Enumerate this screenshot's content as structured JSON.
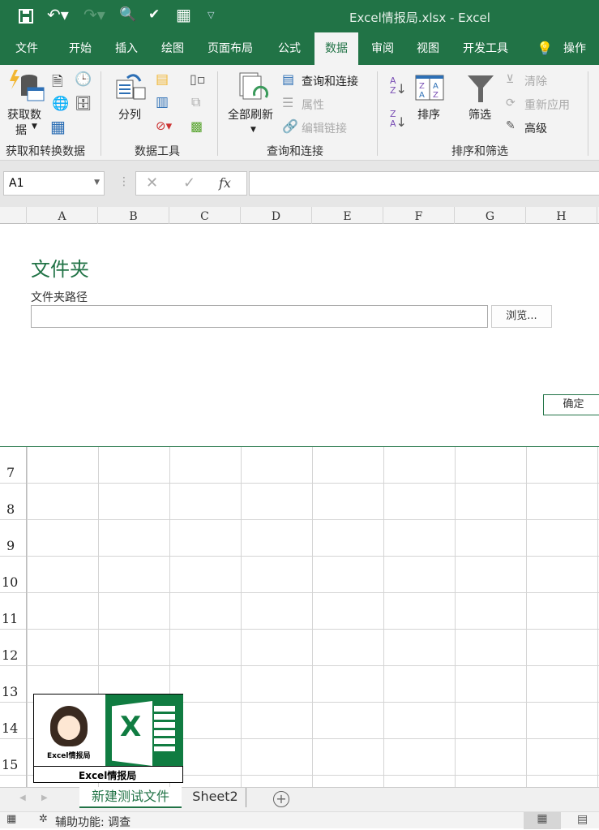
{
  "title_bar": {
    "title": "Excel情报局.xlsx  -  Excel",
    "qat_icons": [
      "save-icon",
      "undo-icon",
      "redo-icon",
      "print-preview-icon",
      "publish-icon",
      "table-icon",
      "customize-icon"
    ]
  },
  "tabs": [
    {
      "label": "文件"
    },
    {
      "label": "开始"
    },
    {
      "label": "插入"
    },
    {
      "label": "绘图"
    },
    {
      "label": "页面布局"
    },
    {
      "label": "公式"
    },
    {
      "label": "数据",
      "active": true
    },
    {
      "label": "审阅"
    },
    {
      "label": "视图"
    },
    {
      "label": "开发工具"
    },
    {
      "label": "操作说"
    }
  ],
  "ribbon": {
    "get_data": {
      "label1": "获取数",
      "label2": "据",
      "group": "获取和转换数据"
    },
    "data_tools": {
      "split": "分列",
      "group": "数据工具"
    },
    "queries": {
      "refresh_all": "全部刷新",
      "queries_connections": "查询和连接",
      "properties": "属性",
      "edit_links": "编辑链接",
      "group": "查询和连接"
    },
    "sort_filter": {
      "sort": "排序",
      "filter": "筛选",
      "clear": "清除",
      "reapply": "重新应用",
      "advanced": "高级",
      "group": "排序和筛选"
    }
  },
  "formula_bar": {
    "name_box": "A1",
    "fx": "fx",
    "formula": ""
  },
  "columns": [
    "A",
    "B",
    "C",
    "D",
    "E",
    "F",
    "G",
    "H"
  ],
  "dialog": {
    "title": "文件夹",
    "path_label": "文件夹路径",
    "path_value": "",
    "browse": "浏览...",
    "ok": "确定"
  },
  "rows": [
    "7",
    "8",
    "9",
    "10",
    "11",
    "12",
    "13",
    "14",
    "15"
  ],
  "logo": {
    "caption": "Excel情报局",
    "small_caption": "Excel情报局"
  },
  "sheets": [
    {
      "label": "新建测试文件",
      "active": true
    },
    {
      "label": "Sheet2"
    }
  ],
  "status": {
    "accessibility": "辅助功能: 调查"
  },
  "colors": {
    "accent": "#217346"
  }
}
